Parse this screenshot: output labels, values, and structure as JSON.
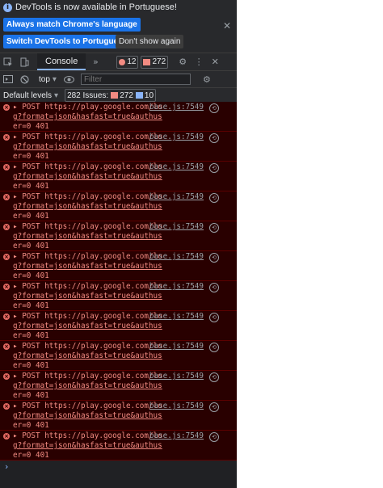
{
  "infobar": {
    "message": "DevTools is now available in Portuguese!",
    "match_button": "Always match Chrome's language",
    "switch_button": "Switch DevTools to Portuguese",
    "dismiss_button": "Don't show again"
  },
  "tabbar": {
    "console_tab": "Console",
    "more_tabs": "»",
    "errors_count": "12",
    "warnings_count": "272"
  },
  "filterbar": {
    "context": "top",
    "filter_placeholder": "Filter"
  },
  "levelbar": {
    "levels_label": "Default levels",
    "issues_label": "282 Issues:",
    "issues_warnings": "272",
    "issues_info": "10"
  },
  "log": [
    {
      "line1": "POST https://play.google.com/lo",
      "line2": "g?format=json&hasfast=true&authus",
      "line3": "er=0 401",
      "source": "base.js:7549"
    },
    {
      "line1": "POST https://play.google.com/lo",
      "line2": "g?format=json&hasfast=true&authus",
      "line3": "er=0 401",
      "source": "base.js:7549"
    },
    {
      "line1": "POST https://play.google.com/lo",
      "line2": "g?format=json&hasfast=true&authus",
      "line3": "er=0 401",
      "source": "base.js:7549"
    },
    {
      "line1": "POST https://play.google.com/lo",
      "line2": "g?format=json&hasfast=true&authus",
      "line3": "er=0 401",
      "source": "base.js:7549"
    },
    {
      "line1": "POST https://play.google.com/lo",
      "line2": "g?format=json&hasfast=true&authus",
      "line3": "er=0 401",
      "source": "base.js:7549"
    },
    {
      "line1": "POST https://play.google.com/lo",
      "line2": "g?format=json&hasfast=true&authus",
      "line3": "er=0 401",
      "source": "base.js:7549"
    },
    {
      "line1": "POST https://play.google.com/lo",
      "line2": "g?format=json&hasfast=true&authus",
      "line3": "er=0 401",
      "source": "base.js:7549"
    },
    {
      "line1": "POST https://play.google.com/lo",
      "line2": "g?format=json&hasfast=true&authus",
      "line3": "er=0 401",
      "source": "base.js:7549"
    },
    {
      "line1": "POST https://play.google.com/lo",
      "line2": "g?format=json&hasfast=true&authus",
      "line3": "er=0 401",
      "source": "base.js:7549"
    },
    {
      "line1": "POST https://play.google.com/lo",
      "line2": "g?format=json&hasfast=true&authus",
      "line3": "er=0 401",
      "source": "base.js:7549"
    },
    {
      "line1": "POST https://play.google.com/lo",
      "line2": "g?format=json&hasfast=true&authus",
      "line3": "er=0 401",
      "source": "base.js:7549"
    },
    {
      "line1": "POST https://play.google.com/lo",
      "line2": "g?format=json&hasfast=true&authus",
      "line3": "er=0 401",
      "source": "base.js:7549"
    }
  ],
  "colors": {
    "panel_bg": "#202124",
    "error_row_bg": "#290000",
    "error_text": "#f28b82",
    "accent_blue": "#1a73e8"
  }
}
